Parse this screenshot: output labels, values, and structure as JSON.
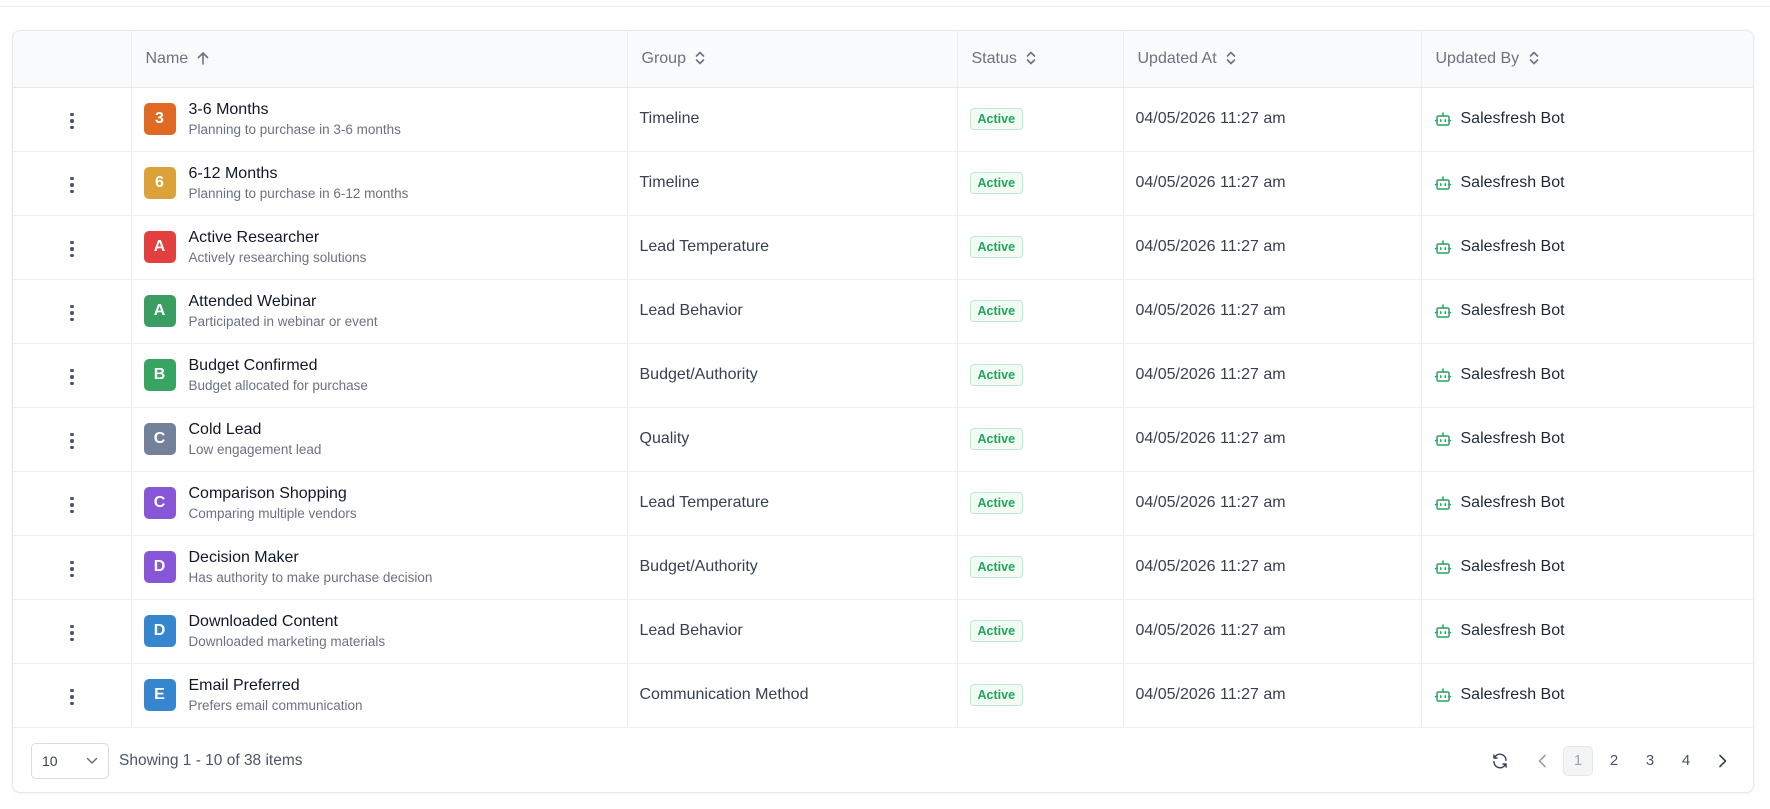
{
  "table": {
    "columns": {
      "name": "Name",
      "group": "Group",
      "status": "Status",
      "updated_at": "Updated At",
      "updated_by": "Updated By"
    },
    "rows": [
      {
        "initial": "3",
        "badge_color": "#e06a24",
        "name": "3-6 Months",
        "description": "Planning to purchase in 3-6 months",
        "group": "Timeline",
        "status": "Active",
        "updated_at": "04/05/2026 11:27 am",
        "updated_by": "Salesfresh Bot"
      },
      {
        "initial": "6",
        "badge_color": "#dba23a",
        "name": "6-12 Months",
        "description": "Planning to purchase in 6-12 months",
        "group": "Timeline",
        "status": "Active",
        "updated_at": "04/05/2026 11:27 am",
        "updated_by": "Salesfresh Bot"
      },
      {
        "initial": "A",
        "badge_color": "#e23f3f",
        "name": "Active Researcher",
        "description": "Actively researching solutions",
        "group": "Lead Temperature",
        "status": "Active",
        "updated_at": "04/05/2026 11:27 am",
        "updated_by": "Salesfresh Bot"
      },
      {
        "initial": "A",
        "badge_color": "#3a9e63",
        "name": "Attended Webinar",
        "description": "Participated in webinar or event",
        "group": "Lead Behavior",
        "status": "Active",
        "updated_at": "04/05/2026 11:27 am",
        "updated_by": "Salesfresh Bot"
      },
      {
        "initial": "B",
        "badge_color": "#37a461",
        "name": "Budget Confirmed",
        "description": "Budget allocated for purchase",
        "group": "Budget/Authority",
        "status": "Active",
        "updated_at": "04/05/2026 11:27 am",
        "updated_by": "Salesfresh Bot"
      },
      {
        "initial": "C",
        "badge_color": "#74819a",
        "name": "Cold Lead",
        "description": "Low engagement lead",
        "group": "Quality",
        "status": "Active",
        "updated_at": "04/05/2026 11:27 am",
        "updated_by": "Salesfresh Bot"
      },
      {
        "initial": "C",
        "badge_color": "#8656d6",
        "name": "Comparison Shopping",
        "description": "Comparing multiple vendors",
        "group": "Lead Temperature",
        "status": "Active",
        "updated_at": "04/05/2026 11:27 am",
        "updated_by": "Salesfresh Bot"
      },
      {
        "initial": "D",
        "badge_color": "#8656d6",
        "name": "Decision Maker",
        "description": "Has authority to make purchase decision",
        "group": "Budget/Authority",
        "status": "Active",
        "updated_at": "04/05/2026 11:27 am",
        "updated_by": "Salesfresh Bot"
      },
      {
        "initial": "D",
        "badge_color": "#3686cf",
        "name": "Downloaded Content",
        "description": "Downloaded marketing materials",
        "group": "Lead Behavior",
        "status": "Active",
        "updated_at": "04/05/2026 11:27 am",
        "updated_by": "Salesfresh Bot"
      },
      {
        "initial": "E",
        "badge_color": "#3686cf",
        "name": "Email Preferred",
        "description": "Prefers email communication",
        "group": "Communication Method",
        "status": "Active",
        "updated_at": "04/05/2026 11:27 am",
        "updated_by": "Salesfresh Bot"
      }
    ]
  },
  "footer": {
    "page_size": "10",
    "showing": "Showing 1 - 10 of 38 items",
    "pages": [
      "1",
      "2",
      "3",
      "4"
    ],
    "current_page": "1"
  },
  "icons": {
    "row_menu": "kebab-menu-icon",
    "sort_asc": "arrow-up-icon",
    "sort_both": "chevron-up-down-icon",
    "updated_by": "robot-icon",
    "refresh": "refresh-icon",
    "prev": "chevron-left-icon",
    "next": "chevron-right-icon",
    "dropdown": "chevron-down-icon"
  },
  "colors": {
    "status_active_text": "#22a55a",
    "robot_icon": "#22a55a"
  }
}
